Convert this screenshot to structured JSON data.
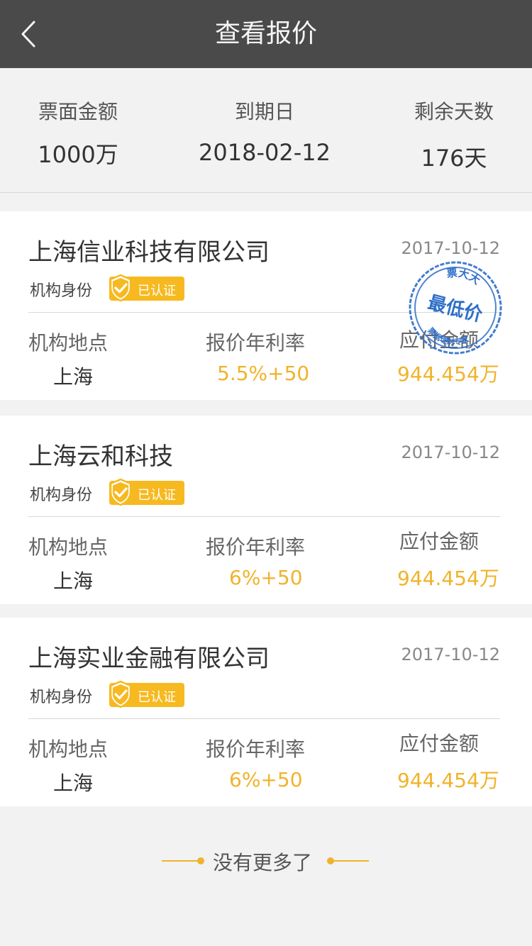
{
  "header": {
    "title": "查看报价",
    "back_icon": "chevron-left-icon"
  },
  "summary": {
    "face_amount_label": "票面金额",
    "face_amount_value": "1000万",
    "due_date_label": "到期日",
    "due_date_value": "2018-02-12",
    "remaining_days_label": "剩余天数",
    "remaining_days_value": "176天"
  },
  "labels": {
    "identity": "机构身份",
    "verified": "已认证",
    "location": "机构地点",
    "rate": "报价年利率",
    "payable": "应付金额"
  },
  "quotes": [
    {
      "company": "上海信业科技有限公司",
      "date": "2017-10-12",
      "location": "上海",
      "rate": "5.5%+50",
      "payable": "944.454万"
    },
    {
      "company": "上海云和科技",
      "date": "2017-10-12",
      "location": "上海",
      "rate": "6%+50",
      "payable": "944.454万"
    },
    {
      "company": "上海实业金融有限公司",
      "date": "2017-10-12",
      "location": "上海",
      "rate": "6%+50",
      "payable": "944.454万"
    }
  ],
  "stamp": {
    "text": "最低价",
    "top_text": "票大大",
    "bottom_text": "票据理财专家",
    "color": "#2f6fc9"
  },
  "footer": {
    "no_more": "没有更多了"
  },
  "colors": {
    "accent": "#f0b32a",
    "navbar": "#4a4a4a",
    "badge": "#f7b920"
  }
}
